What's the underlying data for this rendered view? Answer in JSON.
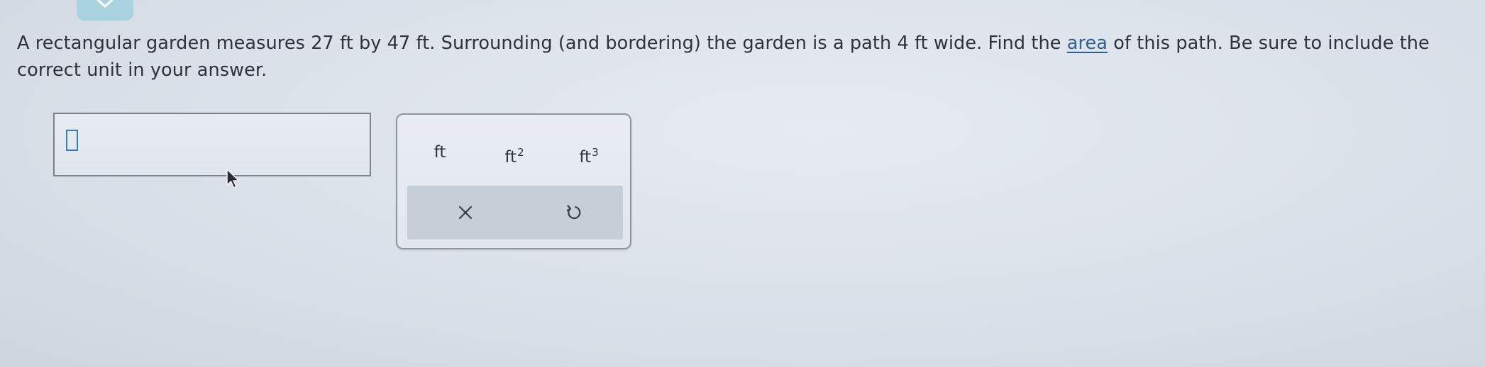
{
  "question": {
    "text_before": "A rectangular garden measures 27 ft by 47 ft. Surrounding (and bordering) the garden is a path 4 ft wide. Find the ",
    "link_text": "area",
    "text_after": " of this path. Be sure to include the correct unit in your answer."
  },
  "answer": {
    "value": ""
  },
  "units": {
    "ft_label": "ft",
    "ft2_base": "ft",
    "ft2_exp": "2",
    "ft3_base": "ft",
    "ft3_exp": "3"
  },
  "actions": {
    "clear_icon": "close-icon",
    "undo_icon": "undo-icon"
  },
  "colors": {
    "link": "#2f5f8c",
    "cursor_accent": "#3a7fb0",
    "tab": "#a8d2de"
  }
}
